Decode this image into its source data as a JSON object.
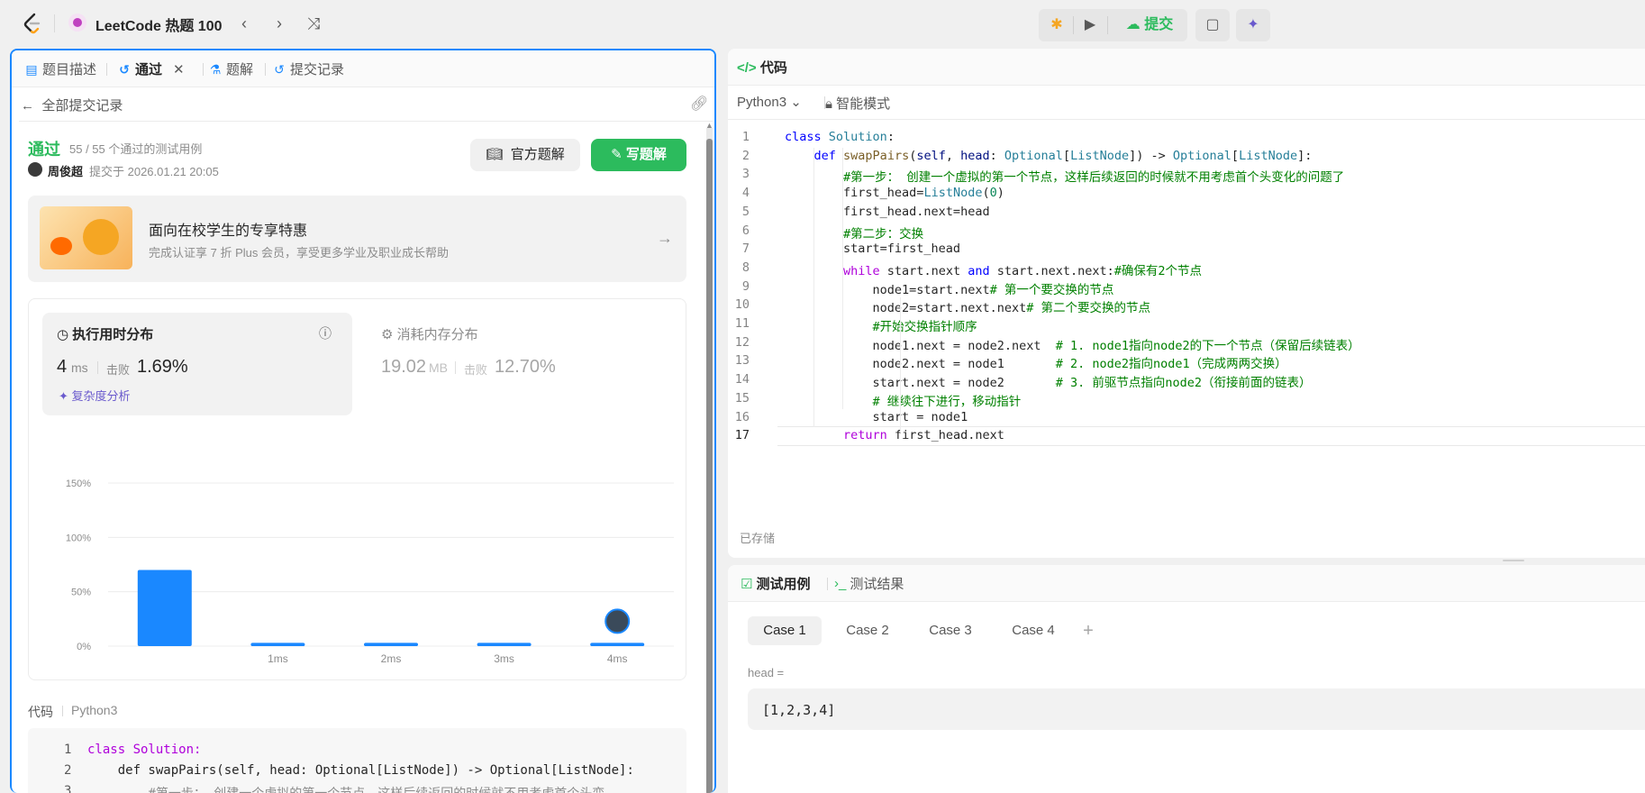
{
  "topbar": {
    "title": "LeetCode 热题 100",
    "submit_label": "提交",
    "icons": [
      "leetcode-logo",
      "chevron-left-icon",
      "chevron-right-icon",
      "shuffle-icon",
      "bug-icon",
      "play-icon",
      "cloud-upload-icon",
      "note-icon",
      "sparkle-icon"
    ]
  },
  "left": {
    "tabs": [
      {
        "label": "题目描述",
        "icon": "document-icon"
      },
      {
        "label": "通过",
        "icon": "history-icon"
      },
      {
        "label": "题解",
        "icon": "flask-icon"
      },
      {
        "label": "提交记录",
        "icon": "history-icon"
      }
    ],
    "back_label": "全部提交记录",
    "status": "通过",
    "cases_text": "55 / 55 个通过的测试用例",
    "user": "周俊超",
    "submitted_at": "提交于 2026.01.21 20:05",
    "official_btn": "官方题解",
    "write_btn": "写题解",
    "promo_title": "面向在校学生的专享特惠",
    "promo_sub": "完成认证享 7 折 Plus 会员，享受更多学业及职业成长帮助",
    "runtime_title": "执行用时分布",
    "runtime_value": "4",
    "runtime_unit": "ms",
    "beats_label": "击败",
    "runtime_beats": "1.69%",
    "complexity": "复杂度分析",
    "memory_title": "消耗内存分布",
    "memory_value": "19.02",
    "memory_unit": "MB",
    "memory_beats": "12.70%",
    "code_label": "代码",
    "lang_label": "Python3"
  },
  "chart_data": {
    "type": "bar",
    "categories": [
      "",
      "1ms",
      "2ms",
      "3ms",
      "4ms"
    ],
    "values": [
      70,
      3,
      3,
      3,
      3
    ],
    "yticks": [
      "150%",
      "100%",
      "50%",
      "0%"
    ],
    "ylim": [
      0,
      150
    ],
    "mini_labels": [
      "1ms",
      "2ms",
      "3ms",
      "4ms"
    ]
  },
  "editor": {
    "title": "代码",
    "language": "Python3",
    "mode": "智能模式",
    "saved": "已存储",
    "lines": [
      "class Solution:",
      "    def swapPairs(self, head: Optional[ListNode]) -> Optional[ListNode]:",
      "        #第一步： 创建一个虚拟的第一个节点，这样后续返回的时候就不用考虑首个头变化的问题了",
      "        first_head=ListNode(0)",
      "        first_head.next=head",
      "        #第二步：交换",
      "        start=first_head",
      "        while start.next and start.next.next:#确保有2个节点",
      "            node1=start.next# 第一个要交换的节点",
      "            node2=start.next.next# 第二个要交换的节点",
      "            #开始交换指针顺序",
      "            node1.next = node2.next  # 1. node1指向node2的下一个节点（保留后续链表）",
      "            node2.next = node1       # 2. node2指向node1（完成两两交换）",
      "            start.next = node2       # 3. 前驱节点指向node2（衔接前面的链表）",
      "            # 继续往下进行，移动指针",
      "            start = node1",
      "        return first_head.next"
    ]
  },
  "preview": {
    "line1": "class Solution:",
    "line2": "    def swapPairs(self, head: Optional[ListNode]) -> Optional[ListNode]:",
    "line3": "        #第一步： 创建一个虚拟的第一个节点，这样后续返回的时候就不用考虑首个头变"
  },
  "testcases": {
    "tab1": "测试用例",
    "tab2": "测试结果",
    "cases": [
      "Case 1",
      "Case 2",
      "Case 3",
      "Case 4"
    ],
    "param": "head =",
    "value": "[1,2,3,4]"
  }
}
